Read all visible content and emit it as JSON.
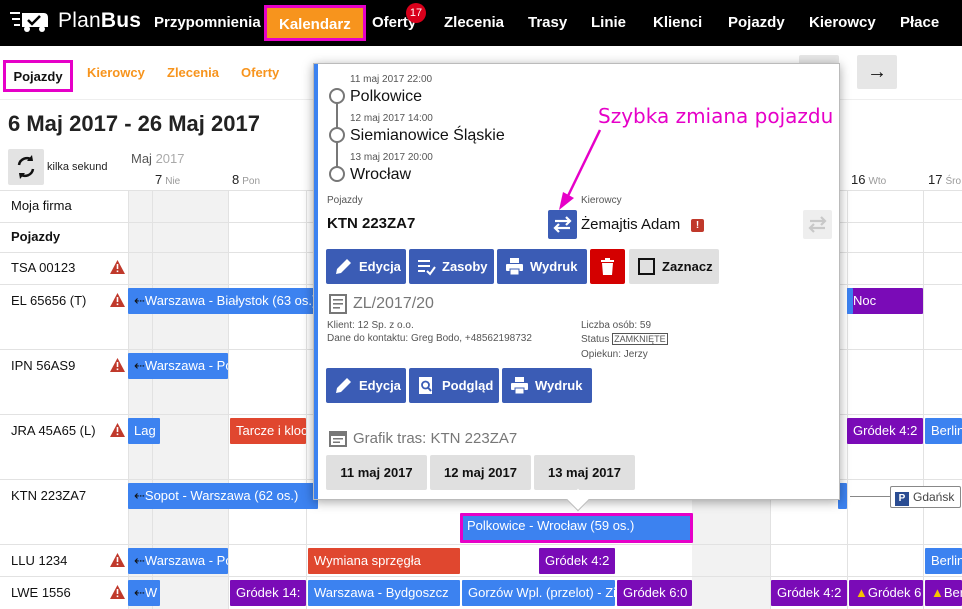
{
  "app": {
    "brand_plan": "Plan",
    "brand_bus": "Bus"
  },
  "navbar": {
    "items": [
      "Przypomnienia",
      "Kalendarz",
      "Oferty",
      "Zlecenia",
      "Trasy",
      "Linie",
      "Klienci",
      "Pojazdy",
      "Kierowcy",
      "Płace"
    ],
    "active": "Kalendarz",
    "oferty_badge": "17"
  },
  "subtabs": {
    "items": [
      "Pojazdy",
      "Kierowcy",
      "Zlecenia",
      "Oferty"
    ],
    "active": "Pojazdy"
  },
  "toolbar": {
    "next_icon": "arrow-right-icon",
    "next_glyph": "→"
  },
  "header": {
    "date_range": "6 Maj 2017 - 26 Maj 2017",
    "refresh_label": "kilka sekund"
  },
  "calendar": {
    "month": "Maj",
    "year": "2017",
    "days": [
      {
        "num": "7",
        "name": "Nie"
      },
      {
        "num": "8",
        "name": "Pon"
      },
      {
        "num": "16",
        "name": "Wto"
      },
      {
        "num": "17",
        "name": "Śro"
      }
    ],
    "rows": [
      {
        "label": "Moja firma",
        "bold": false,
        "warning": false
      },
      {
        "label": "Pojazdy",
        "bold": true,
        "warning": false
      },
      {
        "label": "TSA 00123",
        "bold": false,
        "warning": true
      },
      {
        "label": "EL 65656 (T)",
        "bold": false,
        "warning": true
      },
      {
        "label": "IPN 56AS9",
        "bold": false,
        "warning": true
      },
      {
        "label": "JRA 45A65 (L)",
        "bold": false,
        "warning": true
      },
      {
        "label": "KTN 223ZA7",
        "bold": false,
        "warning": false
      },
      {
        "label": "LLU 1234",
        "bold": false,
        "warning": true
      },
      {
        "label": "LWE 1556",
        "bold": false,
        "warning": true
      }
    ],
    "events": {
      "e1": "Warszawa - Białystok (63 os.)",
      "e2": "Noc",
      "e3": "Warszawa - Pozn",
      "e4": "Lag",
      "e5": "Tarcze i kloc",
      "e6": "Gródek 4:2",
      "e7": "Berlin",
      "e8": "Sopot - Warszawa (62 os.)",
      "e9": "Polkowice - Wrocław (59 os.)",
      "e10": "Warszawa - Pozn",
      "e11": "Wymiana sprzęgła",
      "e12": "Gródek 4:2",
      "e13": "Berlin",
      "e14": "W",
      "e15": "Gródek 14:",
      "e16": "Warszawa - Bydgoszcz",
      "e17": "Gorzów Wpl. (przelot) - Zi",
      "e18": "Gródek 6:0",
      "e19": "Gródek 4:2",
      "e20": "Gródek 6",
      "e21": "Berlin"
    },
    "gdansk_label": "Gdańsk",
    "gdansk_badge": "P"
  },
  "popup": {
    "stops": [
      {
        "time": "11 maj 2017 22:00",
        "city": "Polkowice"
      },
      {
        "time": "12 maj 2017 14:00",
        "city": "Siemianowice Śląskie"
      },
      {
        "time": "13 maj 2017 20:00",
        "city": "Wrocław"
      }
    ],
    "vehicles_label": "Pojazdy",
    "vehicle_plate": "KTN 223ZA7",
    "drivers_label": "Kierowcy",
    "driver_name": "Żemajtis Adam",
    "driver_alert": "!",
    "buttons_top": {
      "edit": "Edycja",
      "resources": "Zasoby",
      "print": "Wydruk",
      "select": "Zaznacz"
    },
    "order_no": "ZL/2017/20",
    "client": "Klient: 12 Sp. z o.o.",
    "contact": "Dane do kontaktu: Greg Bodo, +48562198732",
    "people": "Liczba osób: 59",
    "status_label": "Status",
    "status_value": "ZAMKNIĘTE",
    "guardian": "Opiekun: Jerzy",
    "buttons_order": {
      "edit": "Edycja",
      "preview": "Podgląd",
      "print": "Wydruk"
    },
    "schedule_title": "Grafik tras: KTN 223ZA7",
    "schedule_dates": [
      "11 maj 2017",
      "12 maj 2017",
      "13 maj 2017"
    ]
  },
  "annotation": {
    "text": "Szybka zmiana pojazdu",
    "color": "#e600c8"
  },
  "colors": {
    "accent_orange": "#f7941d",
    "event_blue": "#3c82f0",
    "event_red": "#e0472f",
    "event_purple": "#7a0bb7",
    "button_blue": "#3b5cb5",
    "highlight_magenta": "#e600c8"
  }
}
